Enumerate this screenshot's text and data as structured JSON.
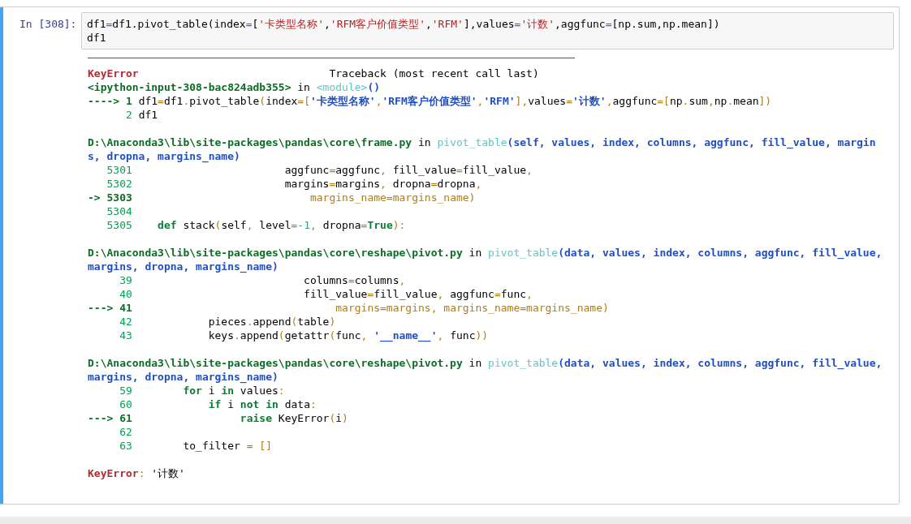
{
  "cell": {
    "prompt": "In [308]:",
    "input": [
      [
        {
          "kind": "n",
          "text": "df1"
        },
        {
          "kind": "op",
          "text": "="
        },
        {
          "kind": "n",
          "text": "df1.pivot_table(index"
        },
        {
          "kind": "op",
          "text": "="
        },
        {
          "kind": "n",
          "text": "["
        },
        {
          "kind": "s",
          "text": "'卡类型名称'"
        },
        {
          "kind": "n",
          "text": ","
        },
        {
          "kind": "s",
          "text": "'RFM客户价值类型'"
        },
        {
          "kind": "n",
          "text": ","
        },
        {
          "kind": "s",
          "text": "'RFM'"
        },
        {
          "kind": "n",
          "text": "],values"
        },
        {
          "kind": "op",
          "text": "="
        },
        {
          "kind": "s",
          "text": "'计数'"
        },
        {
          "kind": "n",
          "text": ",aggfunc"
        },
        {
          "kind": "op",
          "text": "="
        },
        {
          "kind": "n",
          "text": "[np.sum,np.mean])"
        }
      ],
      [
        {
          "kind": "n",
          "text": "df1"
        }
      ]
    ]
  },
  "output": [
    [
      [
        {
          "kind": "ename",
          "text": "KeyError"
        },
        {
          "kind": "n",
          "text": "                              Traceback (most recent call last)"
        }
      ],
      [
        {
          "kind": "path",
          "text": "<ipython-input-308-bac824adb355>"
        },
        {
          "kind": "n",
          "text": " in "
        },
        {
          "kind": "func",
          "text": "<module>"
        },
        {
          "kind": "args",
          "text": "()"
        }
      ],
      [
        {
          "kind": "cur",
          "text": "----> 1 "
        },
        {
          "kind": "n",
          "text": "df1"
        },
        {
          "kind": "p",
          "text": "="
        },
        {
          "kind": "n",
          "text": "df1"
        },
        {
          "kind": "p",
          "text": "."
        },
        {
          "kind": "n",
          "text": "pivot_table"
        },
        {
          "kind": "p",
          "text": "("
        },
        {
          "kind": "n",
          "text": "index"
        },
        {
          "kind": "p",
          "text": "=["
        },
        {
          "kind": "str",
          "text": "'卡类型名称'"
        },
        {
          "kind": "p",
          "text": ","
        },
        {
          "kind": "str",
          "text": "'RFM客户价值类型'"
        },
        {
          "kind": "p",
          "text": ","
        },
        {
          "kind": "str",
          "text": "'RFM'"
        },
        {
          "kind": "p",
          "text": "],"
        },
        {
          "kind": "n",
          "text": "values"
        },
        {
          "kind": "p",
          "text": "="
        },
        {
          "kind": "str",
          "text": "'计数'"
        },
        {
          "kind": "p",
          "text": ","
        },
        {
          "kind": "n",
          "text": "aggfunc"
        },
        {
          "kind": "p",
          "text": "=["
        },
        {
          "kind": "n",
          "text": "np"
        },
        {
          "kind": "p",
          "text": "."
        },
        {
          "kind": "n",
          "text": "sum"
        },
        {
          "kind": "p",
          "text": ","
        },
        {
          "kind": "n",
          "text": "np"
        },
        {
          "kind": "p",
          "text": "."
        },
        {
          "kind": "n",
          "text": "mean"
        },
        {
          "kind": "p",
          "text": "])"
        }
      ],
      [
        {
          "kind": "ln",
          "text": "      2 "
        },
        {
          "kind": "n",
          "text": "df1"
        }
      ]
    ],
    [
      [
        {
          "kind": "path",
          "text": "D:\\Anaconda3\\lib\\site-packages\\pandas\\core\\frame.py"
        },
        {
          "kind": "n",
          "text": " in "
        },
        {
          "kind": "func",
          "text": "pivot_table"
        },
        {
          "kind": "args",
          "text": "(self, values, index, columns, aggfunc, fill_value, margin"
        }
      ],
      [
        {
          "kind": "args",
          "text": "s, dropna, margins_name)"
        }
      ],
      [
        {
          "kind": "ln",
          "text": "   5301 "
        },
        {
          "kind": "n",
          "text": "                       aggfunc"
        },
        {
          "kind": "p",
          "text": "="
        },
        {
          "kind": "n",
          "text": "aggfunc"
        },
        {
          "kind": "p",
          "text": ", "
        },
        {
          "kind": "n",
          "text": "fill_value"
        },
        {
          "kind": "p",
          "text": "="
        },
        {
          "kind": "n",
          "text": "fill_value"
        },
        {
          "kind": "p",
          "text": ","
        }
      ],
      [
        {
          "kind": "ln",
          "text": "   5302 "
        },
        {
          "kind": "n",
          "text": "                       margins"
        },
        {
          "kind": "p",
          "text": "="
        },
        {
          "kind": "n",
          "text": "margins"
        },
        {
          "kind": "p",
          "text": ", "
        },
        {
          "kind": "n",
          "text": "dropna"
        },
        {
          "kind": "p",
          "text": "="
        },
        {
          "kind": "n",
          "text": "dropna"
        },
        {
          "kind": "p",
          "text": ","
        }
      ],
      [
        {
          "kind": "cur",
          "text": "-> 5303 "
        },
        {
          "kind": "p",
          "text": "                           margins_name=margins_name)"
        }
      ],
      [
        {
          "kind": "ln",
          "text": "   5304"
        }
      ],
      [
        {
          "kind": "ln",
          "text": "   5305    "
        },
        {
          "kind": "kw",
          "text": "def"
        },
        {
          "kind": "n",
          "text": " stack"
        },
        {
          "kind": "p",
          "text": "("
        },
        {
          "kind": "n",
          "text": "self"
        },
        {
          "kind": "p",
          "text": ", "
        },
        {
          "kind": "n",
          "text": "level"
        },
        {
          "kind": "p",
          "text": "="
        },
        {
          "kind": "num",
          "text": "-1"
        },
        {
          "kind": "p",
          "text": ", "
        },
        {
          "kind": "n",
          "text": "dropna"
        },
        {
          "kind": "p",
          "text": "="
        },
        {
          "kind": "kw",
          "text": "True"
        },
        {
          "kind": "p",
          "text": "):"
        }
      ]
    ],
    [
      [
        {
          "kind": "path",
          "text": "D:\\Anaconda3\\lib\\site-packages\\pandas\\core\\reshape\\pivot.py"
        },
        {
          "kind": "n",
          "text": " in "
        },
        {
          "kind": "func",
          "text": "pivot_table"
        },
        {
          "kind": "args",
          "text": "(data, values, index, columns, aggfunc, fill_value,"
        }
      ],
      [
        {
          "kind": "args",
          "text": "margins, dropna, margins_name)"
        }
      ],
      [
        {
          "kind": "ln",
          "text": "     39 "
        },
        {
          "kind": "n",
          "text": "                          columns"
        },
        {
          "kind": "p",
          "text": "="
        },
        {
          "kind": "n",
          "text": "columns"
        },
        {
          "kind": "p",
          "text": ","
        }
      ],
      [
        {
          "kind": "ln",
          "text": "     40 "
        },
        {
          "kind": "n",
          "text": "                          fill_value"
        },
        {
          "kind": "p",
          "text": "="
        },
        {
          "kind": "n",
          "text": "fill_value"
        },
        {
          "kind": "p",
          "text": ", "
        },
        {
          "kind": "n",
          "text": "aggfunc"
        },
        {
          "kind": "p",
          "text": "="
        },
        {
          "kind": "n",
          "text": "func"
        },
        {
          "kind": "p",
          "text": ","
        }
      ],
      [
        {
          "kind": "cur",
          "text": "---> 41 "
        },
        {
          "kind": "p",
          "text": "                               margins=margins, margins_name=margins_name)"
        }
      ],
      [
        {
          "kind": "ln",
          "text": "     42 "
        },
        {
          "kind": "n",
          "text": "           pieces"
        },
        {
          "kind": "p",
          "text": "."
        },
        {
          "kind": "n",
          "text": "append"
        },
        {
          "kind": "p",
          "text": "("
        },
        {
          "kind": "n",
          "text": "table"
        },
        {
          "kind": "p",
          "text": ")"
        }
      ],
      [
        {
          "kind": "ln",
          "text": "     43 "
        },
        {
          "kind": "n",
          "text": "           keys"
        },
        {
          "kind": "p",
          "text": "."
        },
        {
          "kind": "n",
          "text": "append"
        },
        {
          "kind": "p",
          "text": "("
        },
        {
          "kind": "n",
          "text": "getattr"
        },
        {
          "kind": "p",
          "text": "("
        },
        {
          "kind": "n",
          "text": "func"
        },
        {
          "kind": "p",
          "text": ", "
        },
        {
          "kind": "str",
          "text": "'__name__'"
        },
        {
          "kind": "p",
          "text": ", "
        },
        {
          "kind": "n",
          "text": "func"
        },
        {
          "kind": "p",
          "text": "))"
        }
      ]
    ],
    [
      [
        {
          "kind": "path",
          "text": "D:\\Anaconda3\\lib\\site-packages\\pandas\\core\\reshape\\pivot.py"
        },
        {
          "kind": "n",
          "text": " in "
        },
        {
          "kind": "func",
          "text": "pivot_table"
        },
        {
          "kind": "args",
          "text": "(data, values, index, columns, aggfunc, fill_value,"
        }
      ],
      [
        {
          "kind": "args",
          "text": "margins, dropna, margins_name)"
        }
      ],
      [
        {
          "kind": "ln",
          "text": "     59        "
        },
        {
          "kind": "kw",
          "text": "for"
        },
        {
          "kind": "n",
          "text": " i "
        },
        {
          "kind": "kw",
          "text": "in"
        },
        {
          "kind": "n",
          "text": " values"
        },
        {
          "kind": "p",
          "text": ":"
        }
      ],
      [
        {
          "kind": "ln",
          "text": "     60            "
        },
        {
          "kind": "kw",
          "text": "if"
        },
        {
          "kind": "n",
          "text": " i "
        },
        {
          "kind": "kw",
          "text": "not in"
        },
        {
          "kind": "n",
          "text": " data"
        },
        {
          "kind": "p",
          "text": ":"
        }
      ],
      [
        {
          "kind": "cur",
          "text": "---> 61                 "
        },
        {
          "kind": "kw",
          "text": "raise"
        },
        {
          "kind": "n",
          "text": " KeyError"
        },
        {
          "kind": "p",
          "text": "("
        },
        {
          "kind": "n",
          "text": "i"
        },
        {
          "kind": "p",
          "text": ")"
        }
      ],
      [
        {
          "kind": "ln",
          "text": "     62"
        }
      ],
      [
        {
          "kind": "ln",
          "text": "     63 "
        },
        {
          "kind": "n",
          "text": "       to_filter "
        },
        {
          "kind": "p",
          "text": "= []"
        }
      ]
    ],
    [
      [
        {
          "kind": "ename",
          "text": "KeyError"
        },
        {
          "kind": "p",
          "text": ": "
        },
        {
          "kind": "n",
          "text": "'计数'"
        }
      ]
    ]
  ]
}
